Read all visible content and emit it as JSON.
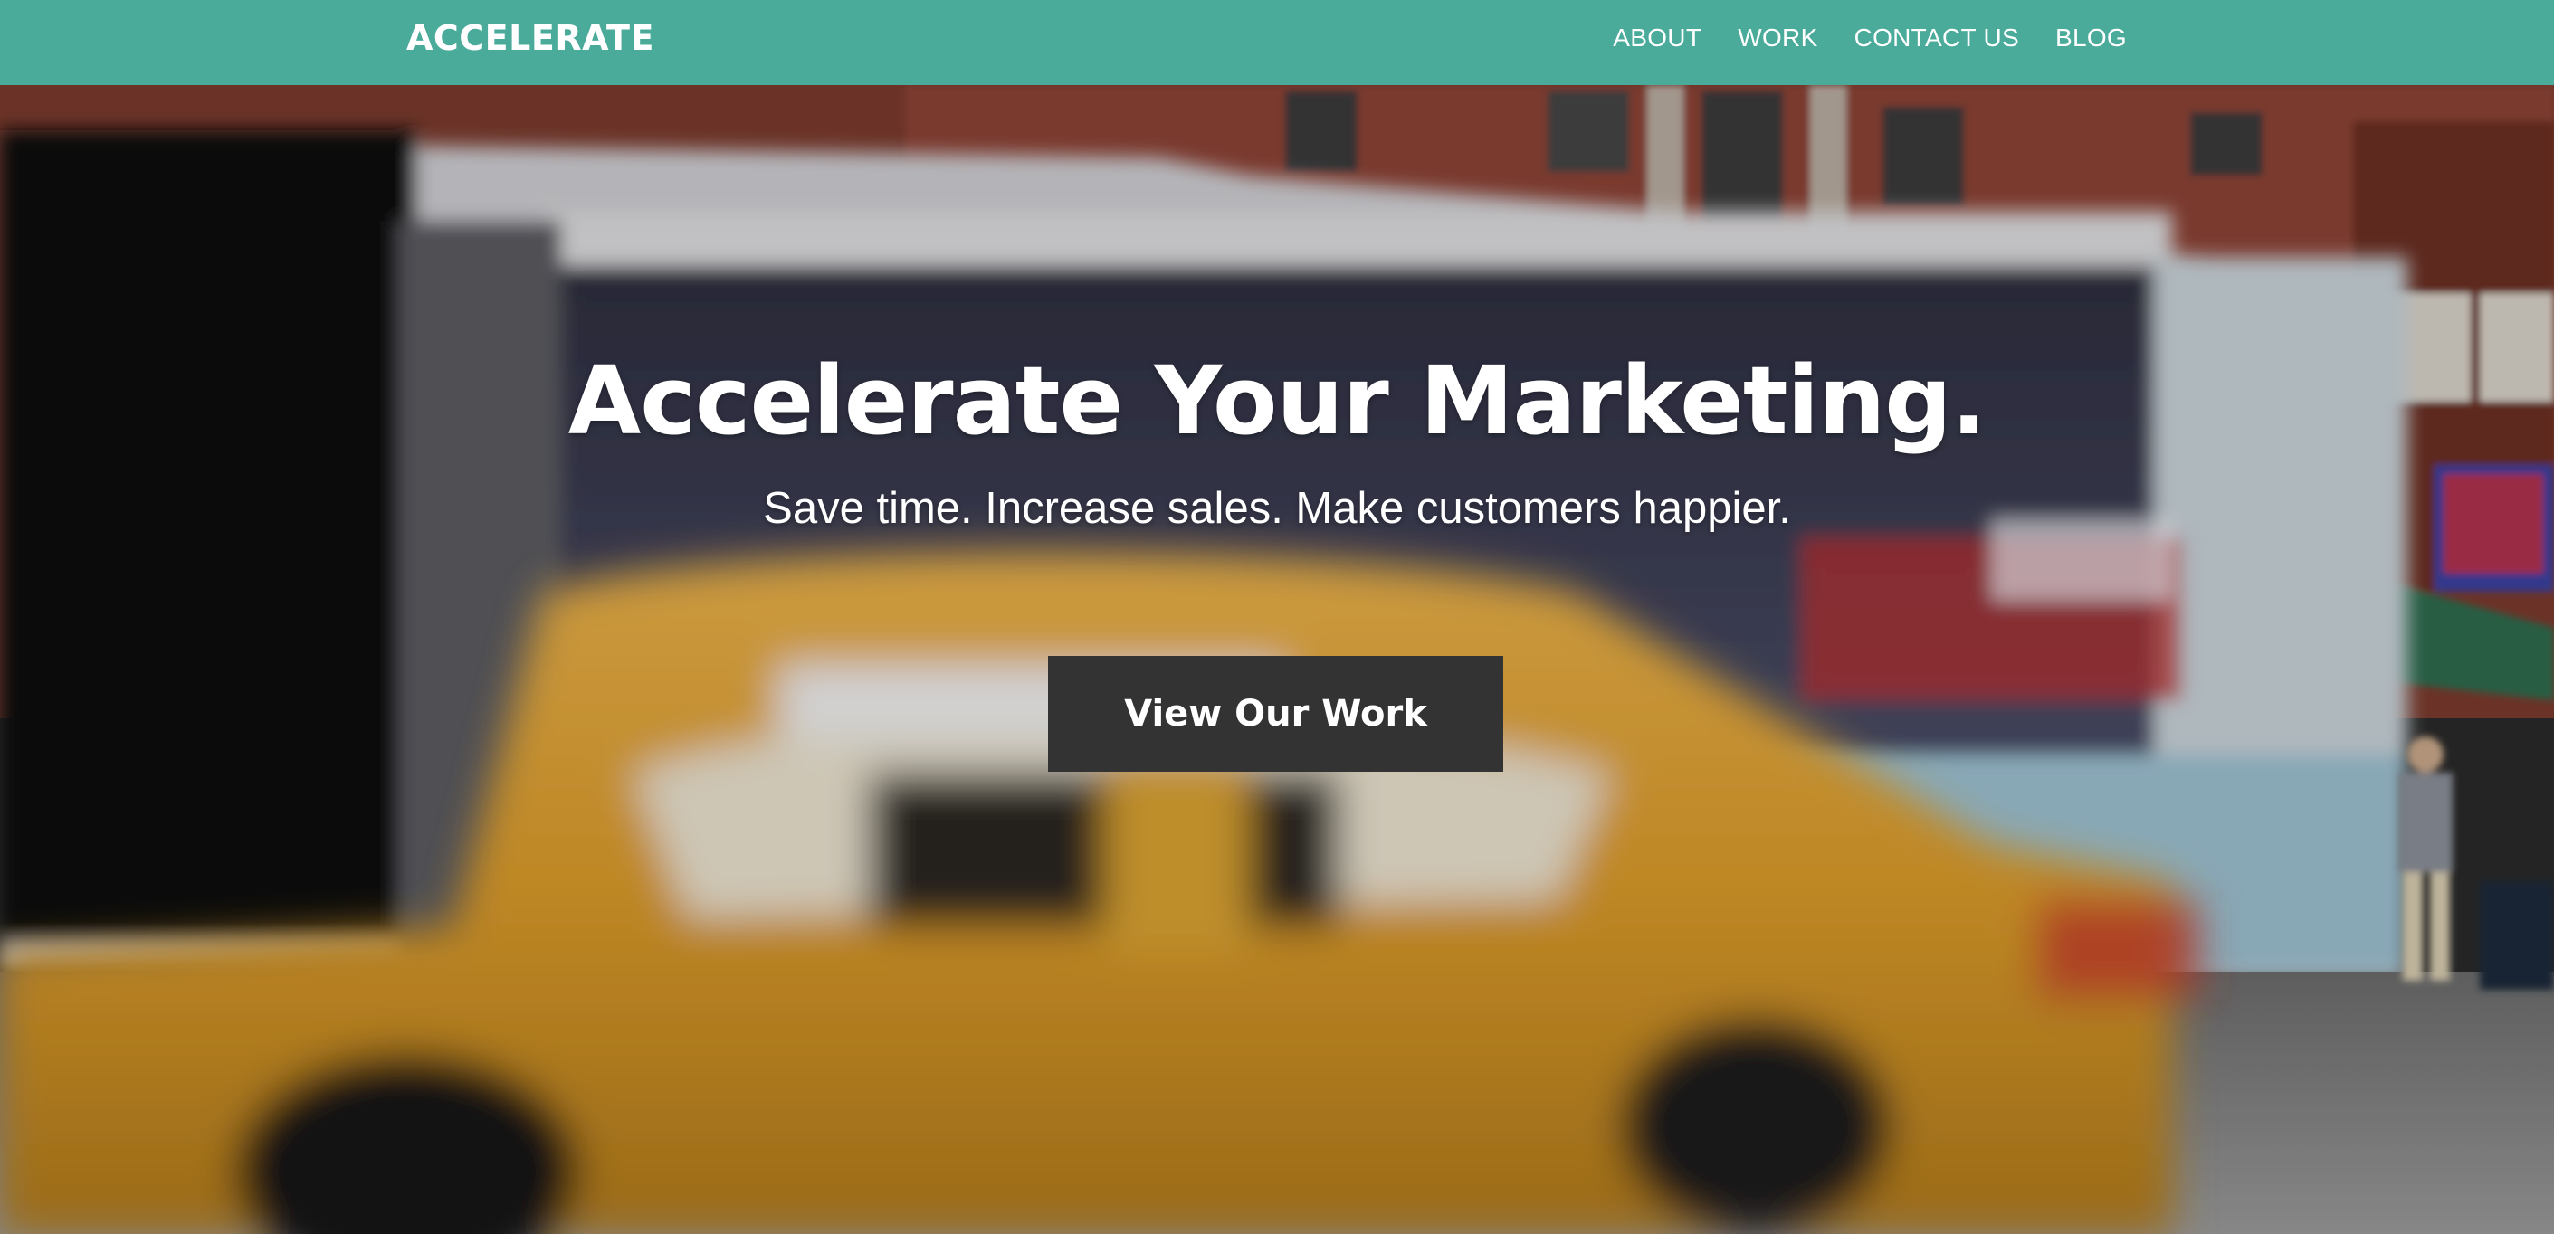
{
  "nav": {
    "brand": "ACCELERATE",
    "links": [
      "ABOUT",
      "WORK",
      "CONTACT US",
      "BLOG"
    ]
  },
  "hero": {
    "headline": "Accelerate Your Marketing.",
    "subheadline": "Save time. Increase sales. Make customers happier.",
    "cta_label": "View Our Work",
    "background_image": "blurred-city-street-with-bus-and-yellow-taxi"
  },
  "colors": {
    "navbar_bg": "#4aab9a",
    "cta_bg": "#333333",
    "text": "#ffffff"
  }
}
